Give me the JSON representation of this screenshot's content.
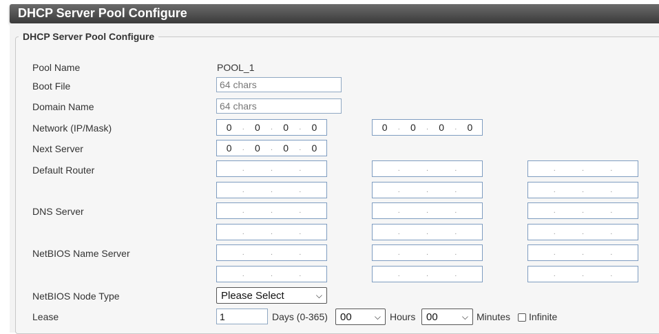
{
  "header": {
    "title": "DHCP Server Pool Configure"
  },
  "section": {
    "legend": "DHCP Server Pool Configure"
  },
  "labels": {
    "pool_name": "Pool Name",
    "boot_file": "Boot File",
    "domain_name": "Domain Name",
    "network": "Network (IP/Mask)",
    "next_server": "Next Server",
    "default_router": "Default Router",
    "dns_server": "DNS Server",
    "netbios_name_server": "NetBIOS Name Server",
    "netbios_node_type": "NetBIOS Node Type",
    "lease": "Lease"
  },
  "values": {
    "pool_name": "POOL_1",
    "boot_file_placeholder": "64 chars",
    "domain_name_placeholder": "64 chars",
    "network_ip": [
      "0",
      "0",
      "0",
      "0"
    ],
    "network_mask": [
      "0",
      "0",
      "0",
      "0"
    ],
    "next_server": [
      "0",
      "0",
      "0",
      "0"
    ],
    "netbios_node_type": "Please Select",
    "lease_days": "1",
    "lease_days_label": "Days (0-365)",
    "lease_hours": "00",
    "lease_hours_label": "Hours",
    "lease_minutes": "00",
    "lease_minutes_label": "Minutes",
    "infinite_label": "Infinite",
    "infinite_checked": false
  },
  "icons": {
    "dropdown": "chevron-down-icon",
    "checkbox": "checkbox-icon"
  }
}
